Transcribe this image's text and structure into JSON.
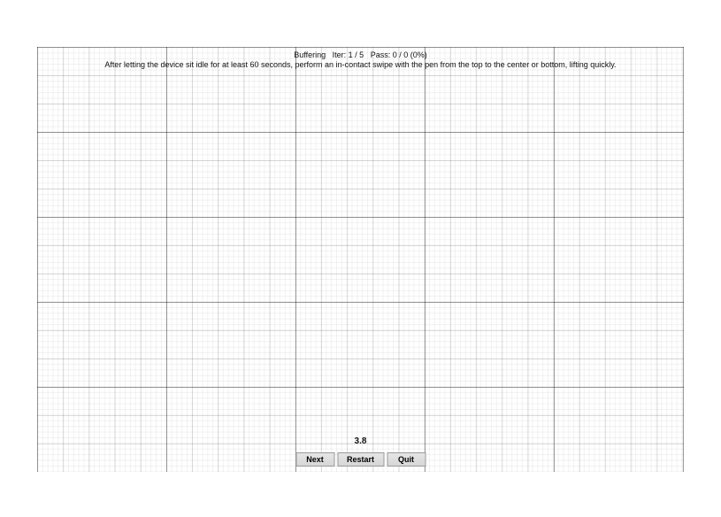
{
  "status": {
    "label_buffering": "Buffering",
    "label_iter": "Iter:",
    "iter_current": 1,
    "iter_total": 5,
    "label_pass": "Pass:",
    "pass_current": 0,
    "pass_total": 0,
    "pass_pct": "0%"
  },
  "instruction": "After letting the device sit idle for at least 60 seconds, perform an in-contact swipe with the pen from the top to the center or bottom, lifting quickly.",
  "timer_value": "3.8",
  "buttons": {
    "next": "Next",
    "restart": "Restart",
    "quit": "Quit"
  }
}
